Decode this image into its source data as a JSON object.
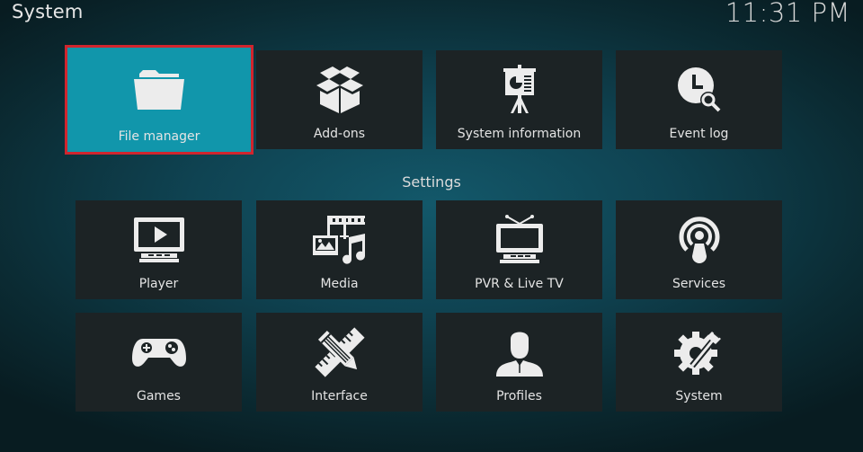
{
  "header": {
    "title": "System",
    "clock": "11:31 PM"
  },
  "top_row": [
    {
      "label": "File manager",
      "icon": "folder-icon",
      "focused": true
    },
    {
      "label": "Add-ons",
      "icon": "open-box-icon"
    },
    {
      "label": "System information",
      "icon": "presentation-board-icon"
    },
    {
      "label": "Event log",
      "icon": "clock-search-icon"
    }
  ],
  "settings": {
    "heading": "Settings",
    "items": [
      {
        "label": "Player",
        "icon": "monitor-play-icon"
      },
      {
        "label": "Media",
        "icon": "media-film-photo-music-icon"
      },
      {
        "label": "PVR & Live TV",
        "icon": "tv-antenna-icon"
      },
      {
        "label": "Services",
        "icon": "broadcast-podcast-icon"
      },
      {
        "label": "Games",
        "icon": "gamepad-icon"
      },
      {
        "label": "Interface",
        "icon": "pencil-ruler-icon"
      },
      {
        "label": "Profiles",
        "icon": "user-profile-icon"
      },
      {
        "label": "System",
        "icon": "gear-wrench-icon"
      }
    ]
  },
  "colors": {
    "focus_fill": "#1196ab",
    "focus_border": "#d0252e",
    "tile_bg": "#1c2325",
    "icon_fill": "#ececec"
  }
}
